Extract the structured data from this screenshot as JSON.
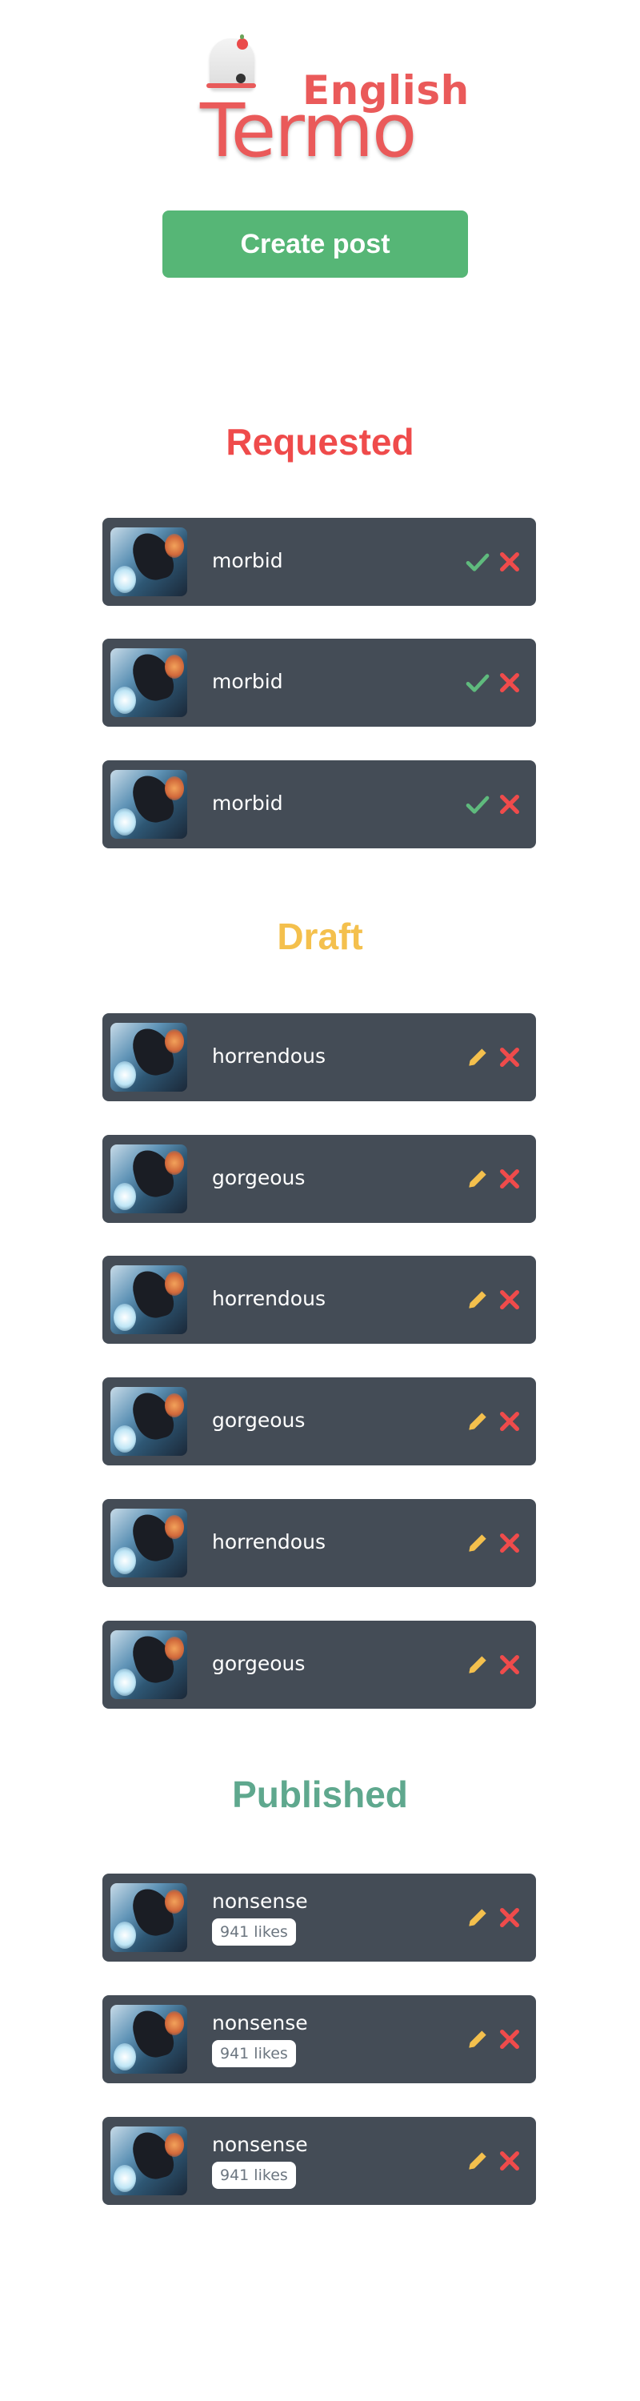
{
  "logo": {
    "sub": "English",
    "main": "Termo"
  },
  "create_button": {
    "label": "Create post"
  },
  "colors": {
    "requested": "#ef4b4b",
    "draft": "#f4c04d",
    "published": "#5fa88e",
    "card": "#444c56",
    "create": "#56b676",
    "check": "#5fba7d",
    "edit": "#f4c04d",
    "delete": "#ef4b4b"
  },
  "requested": {
    "title": "Requested",
    "items": [
      {
        "word": "morbid"
      },
      {
        "word": "morbid"
      },
      {
        "word": "morbid"
      }
    ]
  },
  "draft": {
    "title": "Draft",
    "items": [
      {
        "word": "horrendous"
      },
      {
        "word": "gorgeous"
      },
      {
        "word": "horrendous"
      },
      {
        "word": "gorgeous"
      },
      {
        "word": "horrendous"
      },
      {
        "word": "gorgeous"
      }
    ]
  },
  "published": {
    "title": "Published",
    "items": [
      {
        "word": "nonsense",
        "likes": "941 likes"
      },
      {
        "word": "nonsense",
        "likes": "941 likes"
      },
      {
        "word": "nonsense",
        "likes": "941 likes"
      }
    ]
  },
  "icons": {
    "approve": "check-icon",
    "edit": "pencil-icon",
    "delete": "close-icon",
    "thumbnail": "dragon-thumbnail"
  }
}
